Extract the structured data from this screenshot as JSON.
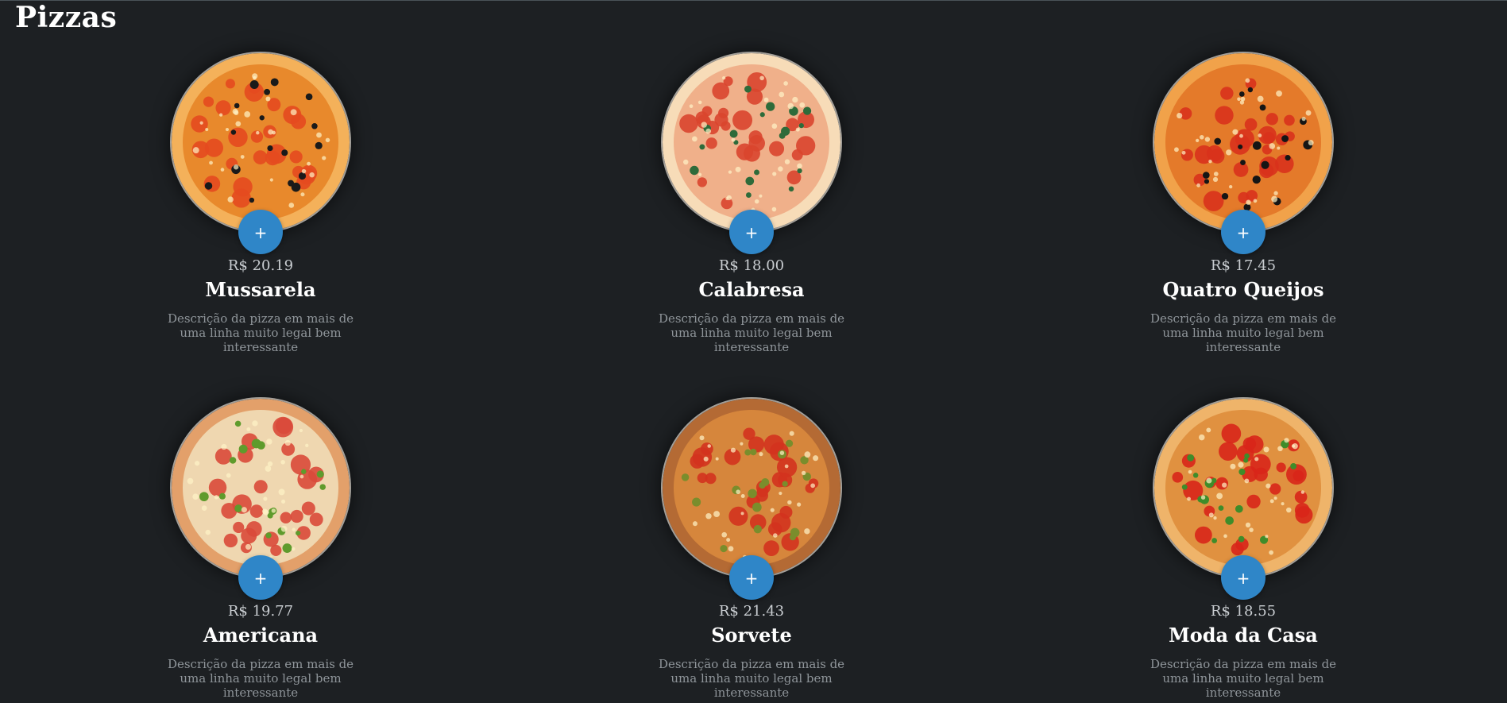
{
  "page": {
    "title": "Pizzas"
  },
  "pizzas": [
    {
      "name": "Mussarela",
      "price": "R$ 20.19",
      "description": "Descrição da pizza em mais de uma linha muito legal bem interessante",
      "add_label": "+",
      "colors": {
        "base": "#e8892c",
        "crust": "#f4b15a",
        "topping": "#e44a1f",
        "accent": "#1a1a1a"
      }
    },
    {
      "name": "Calabresa",
      "price": "R$ 18.00",
      "description": "Descrição da pizza em mais de uma linha muito legal bem interessante",
      "add_label": "+",
      "colors": {
        "base": "#f0b08a",
        "crust": "#f7dcb8",
        "topping": "#d9452e",
        "accent": "#2e6b3a"
      }
    },
    {
      "name": "Quatro Queijos",
      "price": "R$ 17.45",
      "description": "Descrição da pizza em mais de uma linha muito legal bem interessante",
      "add_label": "+",
      "colors": {
        "base": "#e47a2a",
        "crust": "#f1a24a",
        "topping": "#d8321c",
        "accent": "#151515"
      }
    },
    {
      "name": "Americana",
      "price": "R$ 19.77",
      "description": "Descrição da pizza em mais de uma linha muito legal bem interessante",
      "add_label": "+",
      "colors": {
        "base": "#efd7b0",
        "crust": "#e3a06a",
        "topping": "#d94a3a",
        "accent": "#5f9b2c"
      }
    },
    {
      "name": "Sorvete",
      "price": "R$ 21.43",
      "description": "Descrição da pizza em mais de uma linha muito legal bem interessante",
      "add_label": "+",
      "colors": {
        "base": "#d6863c",
        "crust": "#b46a34",
        "topping": "#d3331e",
        "accent": "#7a8d2c"
      }
    },
    {
      "name": "Moda da Casa",
      "price": "R$ 18.55",
      "description": "Descrição da pizza em mais de uma linha muito legal bem interessante",
      "add_label": "+",
      "colors": {
        "base": "#e09140",
        "crust": "#efb46a",
        "topping": "#d8261a",
        "accent": "#3f8c2a"
      }
    }
  ]
}
